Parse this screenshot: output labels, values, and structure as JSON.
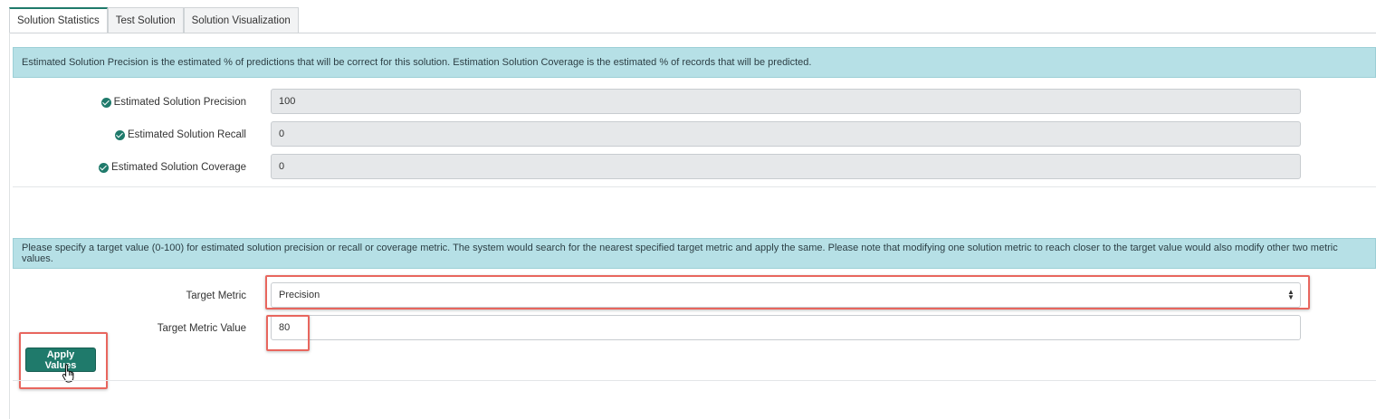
{
  "tabs": [
    {
      "label": "Solution Statistics",
      "active": true
    },
    {
      "label": "Test Solution",
      "active": false
    },
    {
      "label": "Solution Visualization",
      "active": false
    }
  ],
  "statistics": {
    "info": "Estimated Solution Precision is the estimated % of predictions that will be correct for this solution. Estimation Solution Coverage is the estimated % of records that will be predicted.",
    "precision": {
      "label": "Estimated Solution Precision",
      "value": "100"
    },
    "recall": {
      "label": "Estimated Solution Recall",
      "value": "0"
    },
    "coverage": {
      "label": "Estimated Solution Coverage",
      "value": "0"
    }
  },
  "target": {
    "info": "Please specify a target value (0-100) for estimated solution precision or recall or coverage metric. The system would search for the nearest specified target metric and apply the same. Please note that modifying one solution metric to reach closer to the target value would also modify other two metric values.",
    "metric_label": "Target Metric",
    "metric_value": "Precision",
    "value_label": "Target Metric Value",
    "value": "80",
    "apply_label": "Apply Values"
  },
  "colors": {
    "accent": "#1f7a6b",
    "info_bg": "#b6e0e6",
    "highlight": "#e8665e"
  }
}
